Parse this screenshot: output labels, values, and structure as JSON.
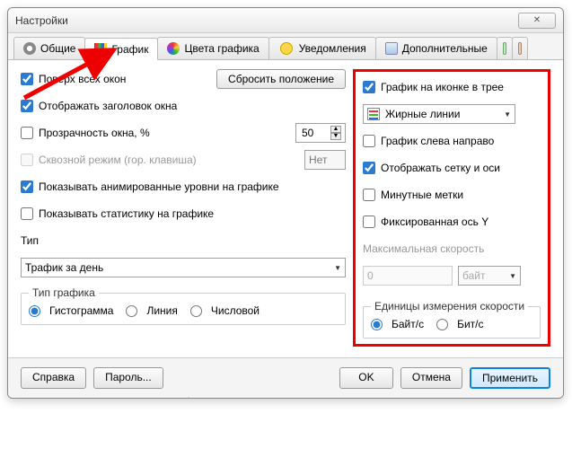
{
  "window": {
    "title": "Настройки"
  },
  "tabs": {
    "general": "Общие",
    "graph": "График",
    "colors": "Цвета графика",
    "notify": "Уведомления",
    "extra": "Дополнительные"
  },
  "left": {
    "on_top": "Поверх всех окон",
    "reset_pos": "Сбросить положение",
    "show_title": "Отображать заголовок окна",
    "opacity_label": "Прозрачность окна, %",
    "opacity_value": "50",
    "passthrough": "Сквозной режим (гор. клавиша)",
    "passthrough_value": "Нет",
    "show_anim": "Показывать анимированные уровни на графике",
    "show_stats": "Показывать статистику на графике",
    "type_label": "Тип",
    "type_value": "Трафик за день",
    "chart_type_label": "Тип графика",
    "ct_histo": "Гистограмма",
    "ct_line": "Линия",
    "ct_number": "Числовой"
  },
  "right": {
    "icon_graph": "График на иконке в трее",
    "line_style": "Жирные линии",
    "left_to_right": "График слева направо",
    "show_grid": "Отображать сетку и оси",
    "minute_marks": "Минутные метки",
    "fixed_y": "Фиксированная ось Y",
    "max_speed_label": "Максимальная скорость",
    "max_speed_value": "0",
    "max_speed_unit": "байт",
    "unit_label": "Единицы измерения скорости",
    "u_byte": "Байт/с",
    "u_bit": "Бит/с"
  },
  "footer": {
    "help": "Справка",
    "password": "Пароль...",
    "ok": "OK",
    "cancel": "Отмена",
    "apply": "Применить"
  }
}
